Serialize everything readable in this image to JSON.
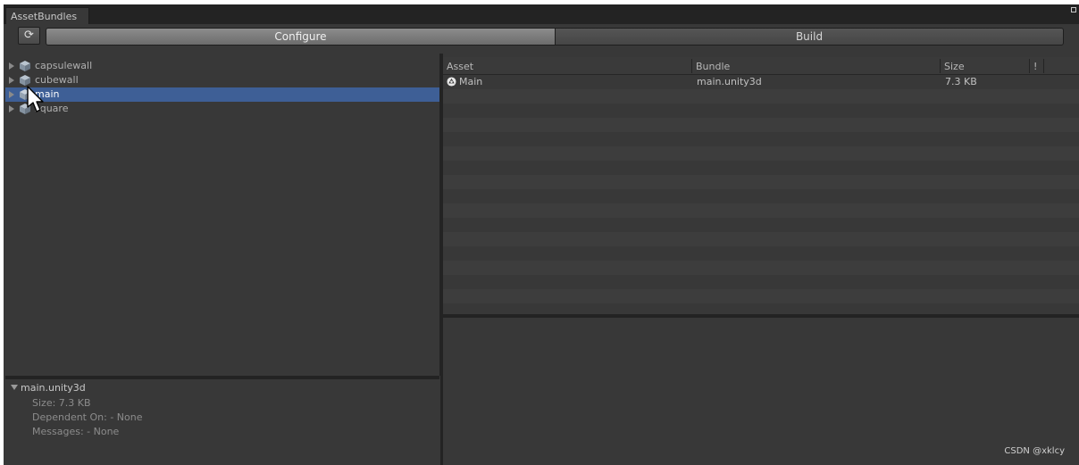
{
  "window": {
    "tab_title": "AssetBundles"
  },
  "toolbar": {
    "refresh_glyph": "⟳",
    "modes": [
      "Configure",
      "Build"
    ],
    "active_mode": "Configure"
  },
  "bundle_tree": {
    "items": [
      {
        "label": "capsulewall",
        "selected": false
      },
      {
        "label": "cubewall",
        "selected": false
      },
      {
        "label": "main",
        "selected": true
      },
      {
        "label": "square",
        "selected": false
      }
    ]
  },
  "bundle_details": {
    "title": "main.unity3d",
    "lines": [
      "Size: 7.3 KB",
      "Dependent On: - None",
      "Messages: - None"
    ]
  },
  "asset_table": {
    "columns": [
      "Asset",
      "Bundle",
      "Size",
      "!"
    ],
    "rows": [
      {
        "asset": "Main",
        "bundle": "main.unity3d",
        "size": "7.3 KB"
      }
    ]
  },
  "watermark": "CSDN @xklcy",
  "colors": {
    "panel_bg": "#383838",
    "selection": "#3e5f96",
    "divider": "#232323"
  }
}
